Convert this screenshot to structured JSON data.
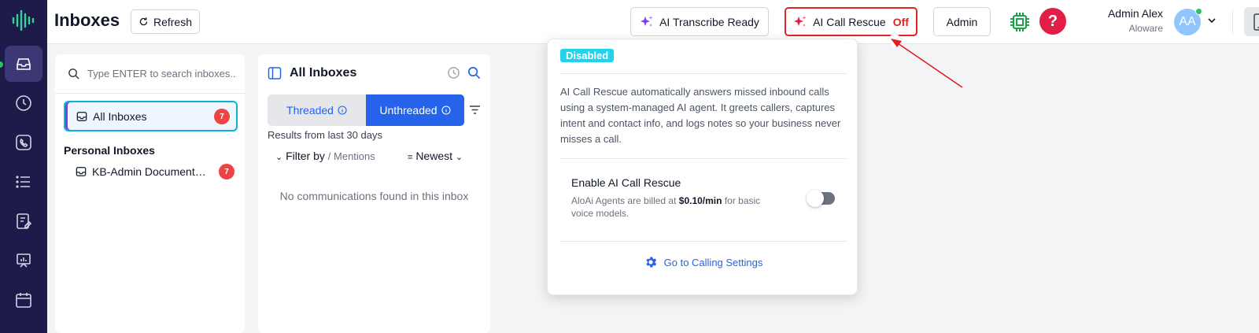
{
  "header": {
    "title": "Inboxes",
    "refresh_label": "Refresh",
    "transcribe_label": "AI Transcribe Ready",
    "rescue_label": "AI Call Rescue",
    "rescue_status": "Off",
    "admin_label": "Admin",
    "help_label": "?",
    "user_name": "Admin Alex",
    "user_org": "Aloware",
    "avatar_initials": "AA"
  },
  "sidebar": {
    "items": [
      "inbox-icon",
      "clock-icon",
      "phone-icon",
      "list-icon",
      "contact-icon",
      "presentation-icon",
      "calendar-icon"
    ],
    "active_index": 0
  },
  "inbox_list": {
    "search_placeholder": "Type ENTER to search inboxes...",
    "all_label": "All Inboxes",
    "all_count": "7",
    "personal_heading": "Personal Inboxes",
    "personal_items": [
      {
        "label": "KB-Admin Documentation",
        "count": "7"
      }
    ]
  },
  "conversations": {
    "title": "All Inboxes",
    "tab_threaded": "Threaded",
    "tab_unthreaded": "Unthreaded",
    "results_text": "Results from last 30 days",
    "filter_label": "Filter by",
    "filter_value": "/ Mentions",
    "sort_label": "Newest",
    "empty_text": "No communications found in this inbox"
  },
  "popover": {
    "status_tag": "Disabled",
    "description": "AI Call Rescue automatically answers missed inbound calls using a system-managed AI agent. It greets callers, captures intent and contact info, and logs notes so your business never misses a call.",
    "enable_title": "Enable AI Call Rescue",
    "billing_prefix": "AloAi Agents are billed at",
    "billing_rate": "$0.10/min",
    "billing_suffix": "for basic voice models.",
    "toggle_on": false,
    "settings_link": "Go to Calling Settings"
  },
  "colors": {
    "rail": "#1e1b4b",
    "accent": "#2563eb",
    "danger": "#dc2626",
    "cyan": "#22d3ee"
  }
}
